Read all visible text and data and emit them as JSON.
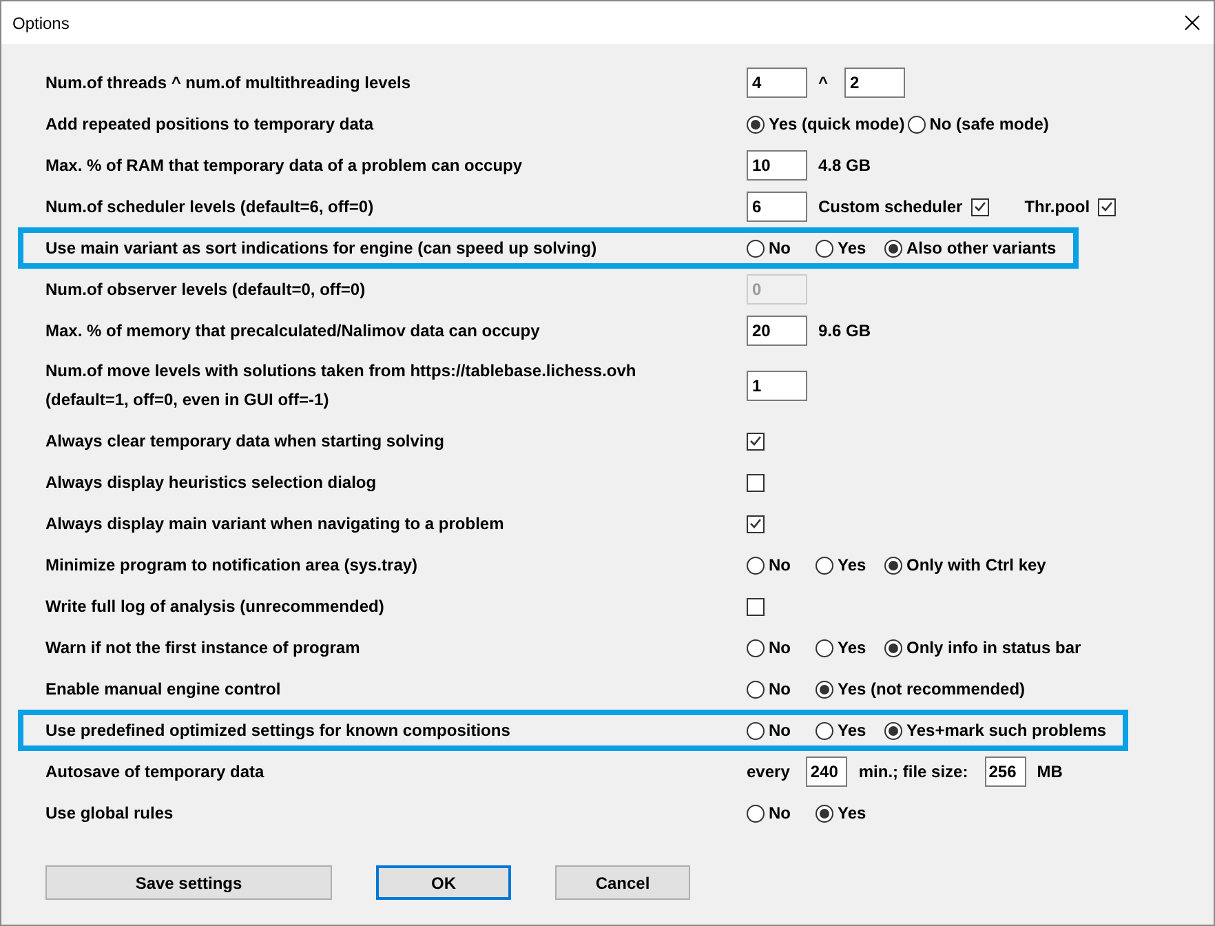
{
  "window": {
    "title": "Options"
  },
  "rows": [
    {
      "label": "Num.of threads ^ num.of multithreading levels",
      "highlighted": false,
      "parts": [
        {
          "kind": "input",
          "value": "4",
          "disabled": false
        },
        {
          "kind": "text",
          "text": "^"
        },
        {
          "kind": "input",
          "value": "2",
          "disabled": false
        }
      ]
    },
    {
      "label": "Add repeated positions to temporary data",
      "highlighted": false,
      "parts": [
        {
          "kind": "radio",
          "label": "Yes (quick mode)",
          "selected": true
        },
        {
          "kind": "radio",
          "label": "No (safe mode)",
          "selected": false
        }
      ]
    },
    {
      "label": "Max. % of RAM that temporary data of a problem can occupy",
      "highlighted": false,
      "parts": [
        {
          "kind": "input",
          "value": "10",
          "disabled": false
        },
        {
          "kind": "text",
          "text": "4.8 GB"
        }
      ]
    },
    {
      "label": "Num.of scheduler levels (default=6, off=0)",
      "highlighted": false,
      "parts": [
        {
          "kind": "input",
          "value": "6",
          "disabled": false
        },
        {
          "kind": "checkbox",
          "label": "Custom scheduler",
          "checked": true
        },
        {
          "kind": "checkbox",
          "label": "Thr.pool",
          "checked": true
        }
      ]
    },
    {
      "label": "Use main variant as sort indications for engine (can speed up solving)",
      "highlighted": true,
      "parts": [
        {
          "kind": "radio",
          "label": "No",
          "selected": false
        },
        {
          "kind": "radio",
          "label": "Yes",
          "selected": false
        },
        {
          "kind": "radio",
          "label": "Also other variants",
          "selected": true
        }
      ]
    },
    {
      "label": "Num.of observer levels (default=0, off=0)",
      "highlighted": false,
      "parts": [
        {
          "kind": "input",
          "value": "0",
          "disabled": true
        }
      ]
    },
    {
      "label": "Max. % of memory that precalculated/Nalimov data can occupy",
      "highlighted": false,
      "parts": [
        {
          "kind": "input",
          "value": "20",
          "disabled": false
        },
        {
          "kind": "text",
          "text": "9.6 GB"
        }
      ]
    },
    {
      "label": "Num.of move levels with solutions taken from https://tablebase.lichess.ovh",
      "label2": "(default=1, off=0, even in GUI off=-1)",
      "highlighted": false,
      "parts": [
        {
          "kind": "input",
          "value": "1",
          "disabled": false
        }
      ]
    },
    {
      "label": "Always clear temporary data when starting solving",
      "highlighted": false,
      "parts": [
        {
          "kind": "checkbox",
          "checked": true
        }
      ]
    },
    {
      "label": "Always display heuristics selection dialog",
      "highlighted": false,
      "parts": [
        {
          "kind": "checkbox",
          "checked": false
        }
      ]
    },
    {
      "label": "Always display main variant when navigating to a problem",
      "highlighted": false,
      "parts": [
        {
          "kind": "checkbox",
          "checked": true
        }
      ]
    },
    {
      "label": "Minimize program to notification area (sys.tray)",
      "highlighted": false,
      "parts": [
        {
          "kind": "radio",
          "label": "No",
          "selected": false
        },
        {
          "kind": "radio",
          "label": "Yes",
          "selected": false
        },
        {
          "kind": "radio",
          "label": "Only with Ctrl key",
          "selected": true
        }
      ]
    },
    {
      "label": "Write full log of analysis (unrecommended)",
      "highlighted": false,
      "parts": [
        {
          "kind": "checkbox",
          "checked": false
        }
      ]
    },
    {
      "label": "Warn if not the first instance of program",
      "highlighted": false,
      "parts": [
        {
          "kind": "radio",
          "label": "No",
          "selected": false
        },
        {
          "kind": "radio",
          "label": "Yes",
          "selected": false
        },
        {
          "kind": "radio",
          "label": "Only info in status bar",
          "selected": true
        }
      ]
    },
    {
      "label": "Enable manual engine control",
      "highlighted": false,
      "parts": [
        {
          "kind": "radio",
          "label": "No",
          "selected": false
        },
        {
          "kind": "radio",
          "label": "Yes (not recommended)",
          "selected": true
        }
      ]
    },
    {
      "label": "Use predefined optimized settings for known compositions",
      "highlighted": true,
      "parts": [
        {
          "kind": "radio",
          "label": "No",
          "selected": false
        },
        {
          "kind": "radio",
          "label": "Yes",
          "selected": false
        },
        {
          "kind": "radio",
          "label": "Yes+mark such problems",
          "selected": true
        }
      ]
    },
    {
      "label": "Autosave of temporary data",
      "highlighted": false,
      "parts": [
        {
          "kind": "text",
          "text": "every"
        },
        {
          "kind": "small_input",
          "value": "240",
          "disabled": false
        },
        {
          "kind": "text",
          "text": "min.; file size:"
        },
        {
          "kind": "small_input",
          "value": "256",
          "disabled": false
        },
        {
          "kind": "text",
          "text": "MB"
        }
      ]
    },
    {
      "label": "Use global rules",
      "highlighted": false,
      "parts": [
        {
          "kind": "radio",
          "label": "No",
          "selected": false
        },
        {
          "kind": "radio",
          "label": "Yes",
          "selected": true
        }
      ]
    }
  ],
  "buttons": [
    {
      "label": "Save settings",
      "default": false
    },
    {
      "label": "OK",
      "default": true
    },
    {
      "label": "Cancel",
      "default": false
    }
  ]
}
